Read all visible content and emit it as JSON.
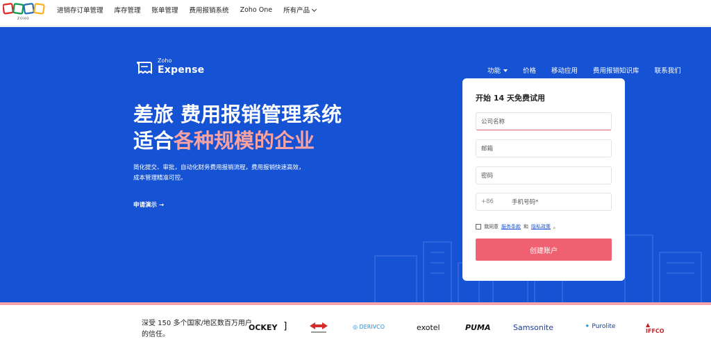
{
  "topnav": {
    "items": [
      "进销存订单管理",
      "库存管理",
      "账单管理",
      "费用报销系统",
      "Zoho One",
      "所有产品"
    ]
  },
  "brand": {
    "zoho": "Zoho",
    "expense": "Expense"
  },
  "mainnav": {
    "items": [
      "功能",
      "价格",
      "移动应用",
      "费用报销知识库",
      "联系我们"
    ]
  },
  "hero": {
    "line1": "差旅 费用报销管理系统",
    "line2_plain": "适合",
    "line2_highlight": "各种规模的企业",
    "subtext_line1": "简化提交、审批，自动化财务费用报销流程，费用报销快速高效，",
    "subtext_line2": "成本管理精准可控。",
    "demo_label": "申请演示"
  },
  "signup": {
    "title": "开始 14 天免费试用",
    "company_placeholder": "公司名称",
    "email_placeholder": "邮箱",
    "password_placeholder": "密码",
    "phone_prefix": "+86",
    "phone_placeholder": "手机号码*",
    "agree_text": "我同意",
    "terms_link": "服务条款",
    "and_text": "和",
    "privacy_link": "隐私政策",
    "agree_suffix": "。",
    "submit_label": "创建账户"
  },
  "trust": {
    "text": "深受 150 多个国家/地区数百万用户的信任。",
    "logos": [
      "OCKEY",
      "DERIVCO",
      "exotel",
      "PUMA",
      "Samsonite",
      "Purolite",
      "IFFCO"
    ]
  },
  "colors": {
    "hero_bg": "#1553d4",
    "accent_pink": "#f8a2a2",
    "button": "#ef6070"
  }
}
